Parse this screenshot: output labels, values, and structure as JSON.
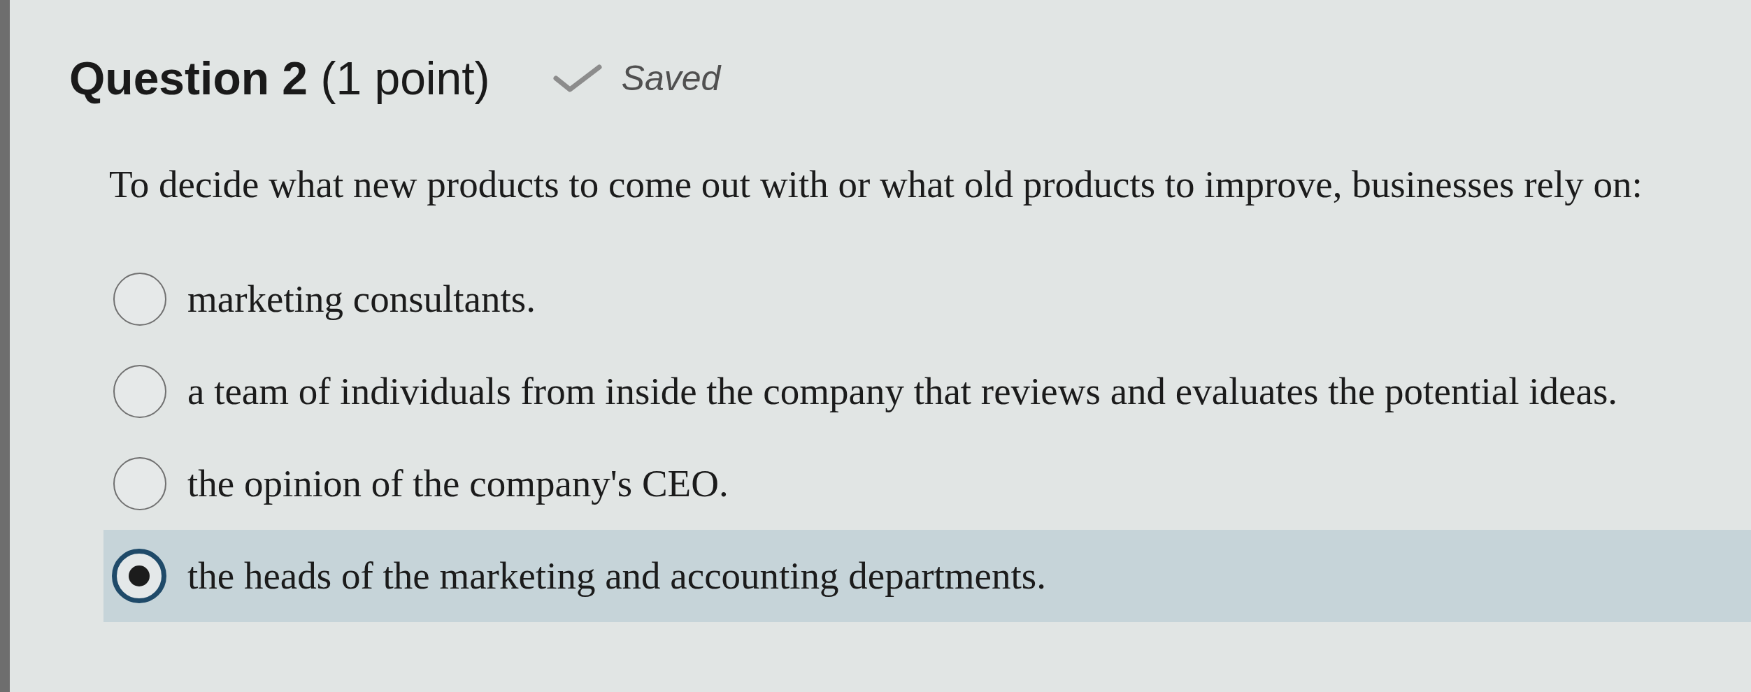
{
  "question": {
    "title": "**Question 2** (1 point)",
    "status": {
      "label": "Saved"
    }
  },
  "prompt": "To decide what new products to come out with or what old products to improve, businesses rely on:",
  "options": [
    {
      "label": "marketing consultants.",
      "selected": false
    },
    {
      "label": "a team of individuals from inside the company that reviews and evaluates the potential ideas.",
      "selected": false
    },
    {
      "label": "the opinion of the company's CEO.",
      "selected": false
    },
    {
      "label": "the heads of the marketing and accounting departments.",
      "selected": true
    }
  ]
}
